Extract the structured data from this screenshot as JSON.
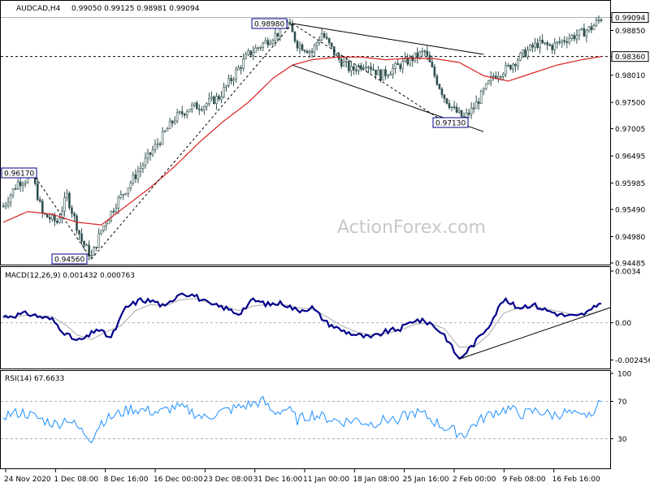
{
  "header": {
    "symbol": "AUDCAD,H4",
    "ohlc": "0.99050 0.99125 0.98981 0.99094"
  },
  "watermark": "ActionForex.com",
  "colors": {
    "candles": "#2f4f4f",
    "ma": "#dc1e1e",
    "macd": "#00008b",
    "signal": "#a9a9a9",
    "rsi": "#1e90ff",
    "trendline": "#000000",
    "grid": "#b0b0b0"
  },
  "chart_data": [
    {
      "type": "candlestick",
      "title": "AUDCAD,H4",
      "ylim": [
        0.94485,
        0.9933
      ],
      "y_ticks": [
        "0.99094",
        "0.98850",
        "0.98360",
        "0.98010",
        "0.97500",
        "0.97005",
        "0.96495",
        "0.95985",
        "0.95490",
        "0.94980",
        "0.94485"
      ],
      "x_labels": [
        "24 Nov 2020",
        "1 Dec 08:00",
        "8 Dec 16:00",
        "16 Dec 00:00",
        "23 Dec 08:00",
        "31 Dec 16:00",
        "11 Jan 00:00",
        "18 Jan 08:00",
        "25 Jan 16:00",
        "2 Feb 00:00",
        "9 Feb 08:00",
        "16 Feb 16:00"
      ],
      "close_anchors": [
        [
          0,
          0.9555
        ],
        [
          6,
          0.96
        ],
        [
          12,
          0.961
        ],
        [
          16,
          0.954
        ],
        [
          22,
          0.9525
        ],
        [
          26,
          0.9575
        ],
        [
          32,
          0.949
        ],
        [
          36,
          0.946
        ],
        [
          40,
          0.951
        ],
        [
          46,
          0.956
        ],
        [
          52,
          0.96
        ],
        [
          58,
          0.964
        ],
        [
          64,
          0.968
        ],
        [
          70,
          0.972
        ],
        [
          76,
          0.974
        ],
        [
          82,
          0.9745
        ],
        [
          88,
          0.976
        ],
        [
          94,
          0.98
        ],
        [
          100,
          0.984
        ],
        [
          106,
          0.986
        ],
        [
          112,
          0.988
        ],
        [
          116,
          0.9898
        ],
        [
          120,
          0.986
        ],
        [
          126,
          0.9845
        ],
        [
          130,
          0.988
        ],
        [
          136,
          0.9835
        ],
        [
          142,
          0.981
        ],
        [
          148,
          0.9825
        ],
        [
          154,
          0.98
        ],
        [
          160,
          0.9815
        ],
        [
          166,
          0.983
        ],
        [
          172,
          0.9845
        ],
        [
          176,
          0.98
        ],
        [
          180,
          0.976
        ],
        [
          184,
          0.9735
        ],
        [
          188,
          0.972
        ],
        [
          192,
          0.974
        ],
        [
          196,
          0.977
        ],
        [
          200,
          0.98
        ],
        [
          206,
          0.9815
        ],
        [
          212,
          0.984
        ],
        [
          218,
          0.986
        ],
        [
          224,
          0.9855
        ],
        [
          230,
          0.987
        ],
        [
          236,
          0.988
        ],
        [
          240,
          0.989
        ],
        [
          244,
          0.9909
        ]
      ],
      "moving_average_anchors": [
        [
          0,
          0.9525
        ],
        [
          10,
          0.9545
        ],
        [
          20,
          0.954
        ],
        [
          30,
          0.9525
        ],
        [
          40,
          0.952
        ],
        [
          50,
          0.9555
        ],
        [
          60,
          0.959
        ],
        [
          70,
          0.963
        ],
        [
          80,
          0.9675
        ],
        [
          90,
          0.9715
        ],
        [
          100,
          0.975
        ],
        [
          110,
          0.9795
        ],
        [
          118,
          0.982
        ],
        [
          126,
          0.983
        ],
        [
          136,
          0.9835
        ],
        [
          146,
          0.9835
        ],
        [
          156,
          0.983
        ],
        [
          166,
          0.9833
        ],
        [
          176,
          0.9832
        ],
        [
          186,
          0.9825
        ],
        [
          196,
          0.98
        ],
        [
          206,
          0.979
        ],
        [
          216,
          0.9805
        ],
        [
          226,
          0.982
        ],
        [
          236,
          0.983
        ],
        [
          244,
          0.9836
        ]
      ],
      "current_price": 0.99094,
      "horizontal_level": 0.9836,
      "annotations": [
        {
          "text": "0.98980",
          "value": 0.9898
        },
        {
          "text": "0.96170",
          "value": 0.9617
        },
        {
          "text": "0.94560",
          "value": 0.9456
        },
        {
          "text": "0.97130",
          "value": 0.9713
        }
      ]
    },
    {
      "type": "line",
      "title": "MACD(12,26,9) 0.001432 0.000763",
      "ylim": [
        -0.0028,
        0.0034
      ],
      "y_ticks": [
        "0.0034",
        "0.00",
        "-0.002456"
      ],
      "series": [
        {
          "name": "MACD",
          "anchors": [
            [
              0,
              0.0004
            ],
            [
              10,
              0.0006
            ],
            [
              20,
              0.0002
            ],
            [
              26,
              -0.0008
            ],
            [
              30,
              -0.0012
            ],
            [
              34,
              -0.001
            ],
            [
              38,
              -0.0004
            ],
            [
              44,
              -0.001
            ],
            [
              50,
              0.001
            ],
            [
              56,
              0.0015
            ],
            [
              62,
              0.0014
            ],
            [
              66,
              0.001
            ],
            [
              72,
              0.002
            ],
            [
              78,
              0.0018
            ],
            [
              84,
              0.0012
            ],
            [
              90,
              0.001
            ],
            [
              96,
              0.0006
            ],
            [
              102,
              0.0015
            ],
            [
              108,
              0.0012
            ],
            [
              114,
              0.0013
            ],
            [
              120,
              0.0008
            ],
            [
              126,
              0.001
            ],
            [
              132,
              0.0
            ],
            [
              138,
              -0.0005
            ],
            [
              144,
              -0.0008
            ],
            [
              150,
              -0.001
            ],
            [
              156,
              -0.0006
            ],
            [
              162,
              -0.0004
            ],
            [
              168,
              0.0002
            ],
            [
              174,
              0.0
            ],
            [
              180,
              -0.0008
            ],
            [
              186,
              -0.0024
            ],
            [
              192,
              -0.0014
            ],
            [
              198,
              -0.0002
            ],
            [
              204,
              0.0015
            ],
            [
              210,
              0.001
            ],
            [
              216,
              0.0012
            ],
            [
              222,
              0.0008
            ],
            [
              228,
              0.0005
            ],
            [
              234,
              0.0004
            ],
            [
              240,
              0.0008
            ],
            [
              244,
              0.0014
            ]
          ]
        },
        {
          "name": "Signal",
          "anchors": [
            [
              0,
              0.0003
            ],
            [
              10,
              0.0005
            ],
            [
              20,
              0.0004
            ],
            [
              26,
              -0.0002
            ],
            [
              30,
              -0.0008
            ],
            [
              36,
              -0.0011
            ],
            [
              42,
              -0.0006
            ],
            [
              48,
              -0.0002
            ],
            [
              54,
              0.0008
            ],
            [
              60,
              0.0012
            ],
            [
              66,
              0.0011
            ],
            [
              72,
              0.0015
            ],
            [
              78,
              0.0016
            ],
            [
              84,
              0.0013
            ],
            [
              90,
              0.0011
            ],
            [
              96,
              0.0008
            ],
            [
              102,
              0.0011
            ],
            [
              108,
              0.0012
            ],
            [
              114,
              0.0012
            ],
            [
              120,
              0.001
            ],
            [
              126,
              0.0009
            ],
            [
              132,
              0.0004
            ],
            [
              138,
              -0.0002
            ],
            [
              144,
              -0.0006
            ],
            [
              150,
              -0.0008
            ],
            [
              156,
              -0.0007
            ],
            [
              162,
              -0.0005
            ],
            [
              168,
              -0.0001
            ],
            [
              174,
              0.0
            ],
            [
              180,
              -0.0004
            ],
            [
              186,
              -0.0016
            ],
            [
              192,
              -0.0016
            ],
            [
              198,
              -0.0008
            ],
            [
              204,
              0.0006
            ],
            [
              210,
              0.001
            ],
            [
              216,
              0.0011
            ],
            [
              222,
              0.0009
            ],
            [
              228,
              0.0007
            ],
            [
              234,
              0.0005
            ],
            [
              240,
              0.0006
            ],
            [
              244,
              0.0008
            ]
          ]
        }
      ],
      "trendline": [
        [
          186,
          -0.0024
        ],
        [
          244,
          0.0008
        ]
      ]
    },
    {
      "type": "line",
      "title": "RSI(14) 67.6633",
      "ylim": [
        0,
        100
      ],
      "y_ticks": [
        "100",
        "70",
        "30",
        "0"
      ],
      "levels": [
        70,
        30
      ],
      "series": [
        {
          "name": "RSI",
          "anchors": [
            [
              0,
              55
            ],
            [
              8,
              58
            ],
            [
              16,
              50
            ],
            [
              22,
              45
            ],
            [
              26,
              52
            ],
            [
              32,
              38
            ],
            [
              36,
              30
            ],
            [
              40,
              48
            ],
            [
              46,
              55
            ],
            [
              52,
              62
            ],
            [
              58,
              60
            ],
            [
              64,
              58
            ],
            [
              70,
              64
            ],
            [
              76,
              60
            ],
            [
              82,
              52
            ],
            [
              88,
              58
            ],
            [
              94,
              62
            ],
            [
              100,
              66
            ],
            [
              106,
              70
            ],
            [
              110,
              58
            ],
            [
              116,
              62
            ],
            [
              120,
              50
            ],
            [
              126,
              56
            ],
            [
              132,
              52
            ],
            [
              138,
              48
            ],
            [
              144,
              50
            ],
            [
              150,
              46
            ],
            [
              156,
              50
            ],
            [
              162,
              52
            ],
            [
              168,
              58
            ],
            [
              172,
              55
            ],
            [
              176,
              48
            ],
            [
              180,
              42
            ],
            [
              184,
              38
            ],
            [
              188,
              34
            ],
            [
              192,
              45
            ],
            [
              196,
              52
            ],
            [
              200,
              58
            ],
            [
              206,
              62
            ],
            [
              212,
              56
            ],
            [
              218,
              60
            ],
            [
              224,
              55
            ],
            [
              230,
              58
            ],
            [
              236,
              52
            ],
            [
              240,
              60
            ],
            [
              244,
              67.66
            ]
          ]
        }
      ]
    }
  ]
}
